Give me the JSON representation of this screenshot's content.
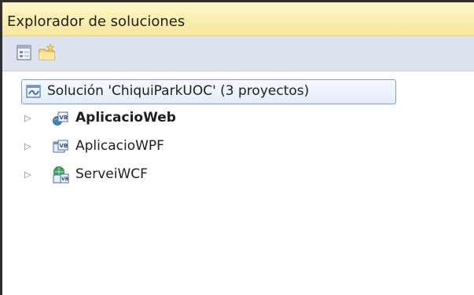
{
  "panel": {
    "title": "Explorador de soluciones"
  },
  "toolbar": {
    "buttons": [
      {
        "icon": "properties-icon"
      },
      {
        "icon": "new-folder-icon"
      }
    ]
  },
  "tree": {
    "solution": {
      "label": "Solución 'ChiquiParkUOC'  (3 proyectos)",
      "icon": "solution-icon",
      "selected": true
    },
    "projects": [
      {
        "label": "AplicacioWeb",
        "icon": "vb-web-project-icon",
        "bold": true,
        "expanded": false
      },
      {
        "label": "AplicacioWPF",
        "icon": "vb-wpf-project-icon",
        "bold": false,
        "expanded": false
      },
      {
        "label": "ServeiWCF",
        "icon": "wcf-service-project-icon",
        "bold": false,
        "expanded": false
      }
    ]
  },
  "colors": {
    "title_bar": "#f7e89b",
    "toolbar": "#dde3ee",
    "selection_border": "#7da2ce"
  }
}
